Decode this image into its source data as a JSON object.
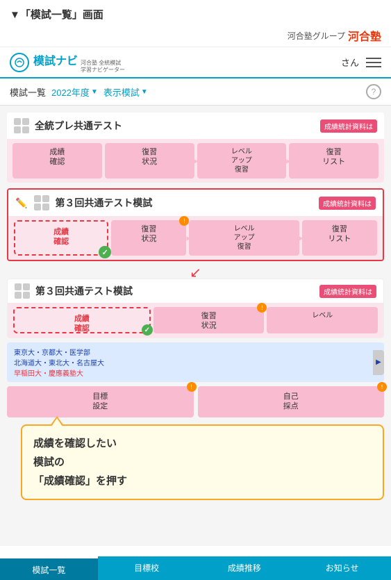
{
  "page": {
    "title_prefix": "▼「",
    "title_main": "模試一覧",
    "title_suffix": "」画面"
  },
  "brand": {
    "group_label": "河合塾グループ",
    "brand_name": "河合塾"
  },
  "header": {
    "logo_text": "模試ナビ",
    "logo_sub_line1": "河合塾 全統模試",
    "logo_sub_line2": "学習ナビゲーター",
    "user_suffix": "さん"
  },
  "filter": {
    "label": "模試一覧",
    "year": "2022年度",
    "display": "表示模試",
    "help": "?"
  },
  "exams": [
    {
      "id": "zentoupra",
      "title": "全統プレ共通テスト",
      "badge": "成績統計資料は",
      "actions": [
        {
          "label": "成績\n確認",
          "warning": false
        },
        {
          "label": "復習\n状況",
          "warning": false
        },
        {
          "label": "レベル\nアップ\n復習",
          "warning": false
        },
        {
          "label": "復習\nリスト",
          "warning": false
        }
      ]
    },
    {
      "id": "third-common-highlighted",
      "title": "第３回共通テスト模試",
      "badge": "成績統計資料は",
      "highlighted": true,
      "actions": [
        {
          "label": "成績\n確認",
          "warning": false,
          "dashed": true,
          "checked": true
        },
        {
          "label": "復習\n状況",
          "warning": true
        },
        {
          "label": "レベル\nアップ\n復習",
          "warning": false,
          "levelup": true
        },
        {
          "label": "復習\nリスト",
          "warning": false
        }
      ]
    },
    {
      "id": "third-common-lower",
      "title": "第３回共通テスト模試",
      "badge": "成績統計資料は",
      "actions": [
        {
          "label": "成績\n確認",
          "warning": false,
          "dashed": true,
          "checked": true
        },
        {
          "label": "復習\n状況",
          "warning": true
        },
        {
          "label": "レベル",
          "warning": false,
          "partial": true
        }
      ]
    }
  ],
  "university_section": {
    "lines": [
      "東京大・京都大・医学部",
      "北海道大・東北大・名古屋大",
      "早稲田大・慶應義塾大"
    ]
  },
  "goal_section": {
    "mokuhyo": "目標\n設定",
    "jiko": "自己\n採点",
    "warning_mokuhyo": true,
    "warning_jiko": true
  },
  "tooltip": {
    "text_line1": "成績を確認したい",
    "text_line2": "模試の",
    "text_line3": "「成績確認」を押す"
  },
  "bottom_nav": [
    {
      "label": "模試一覧",
      "active": true
    },
    {
      "label": "目標校",
      "active": false
    },
    {
      "label": "成績推移",
      "active": false
    },
    {
      "label": "お知らせ",
      "active": false
    }
  ]
}
